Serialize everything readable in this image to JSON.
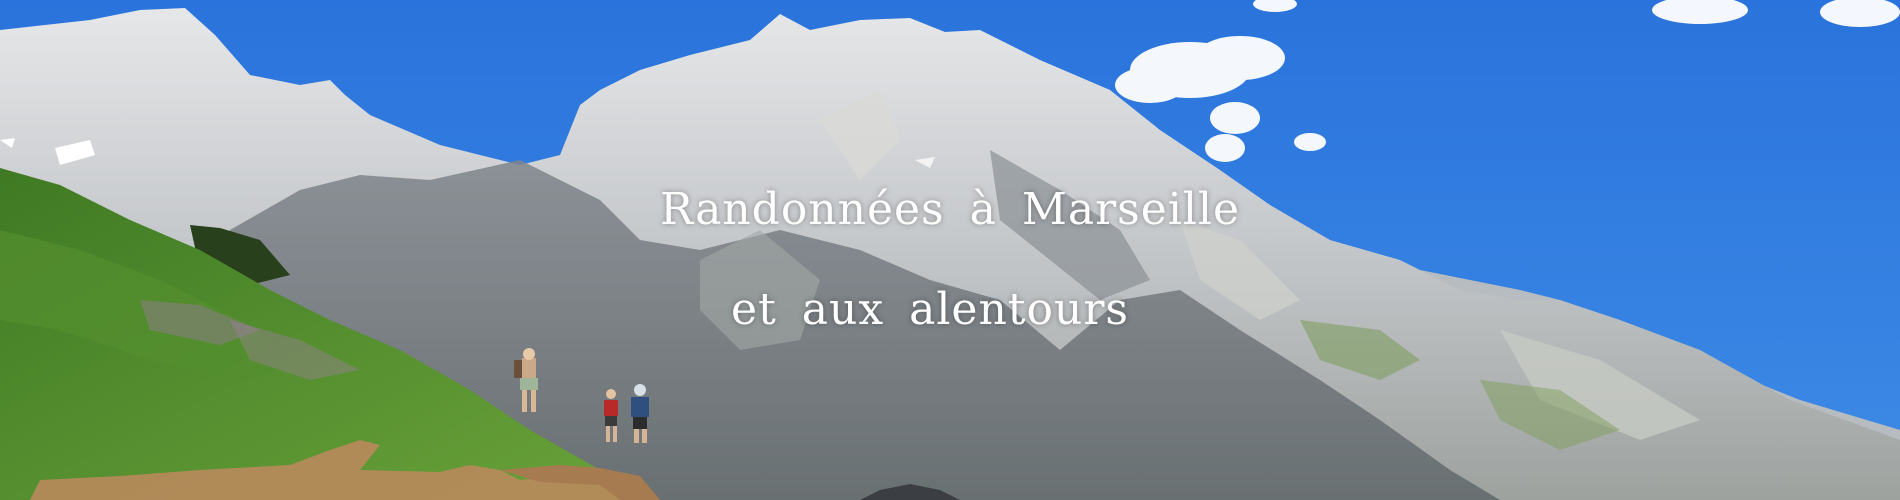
{
  "hero": {
    "title_line_1": "Randonnées à Marseille",
    "title_line_2": "et aux alentours",
    "image": "mountain-hikers-banner"
  },
  "colors": {
    "sky": "#2f7ce0",
    "rock": "#c9ccd0",
    "grass": "#4f8a2b",
    "text": "#ffffff"
  }
}
